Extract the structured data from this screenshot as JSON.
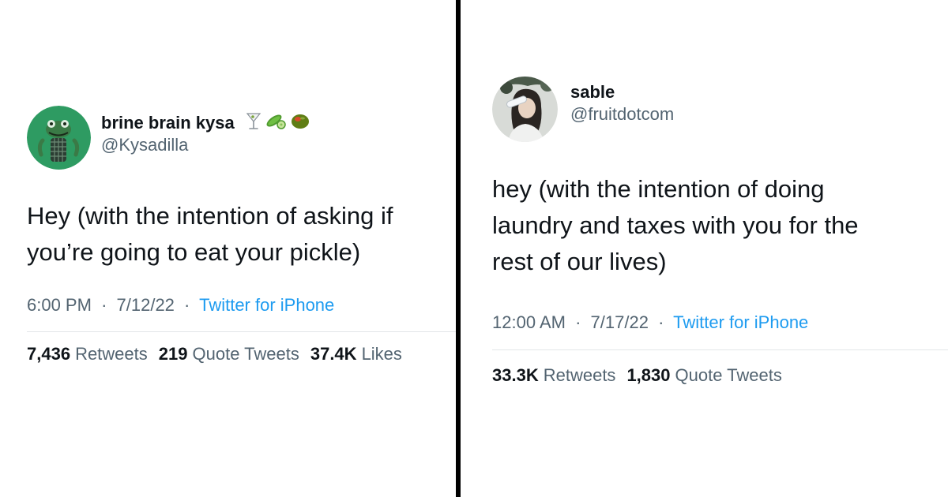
{
  "tweets": [
    {
      "display_name": "brine brain kysa",
      "emoji": [
        "martini-glass",
        "cucumber",
        "olive"
      ],
      "handle": "@Kysadilla",
      "text": "Hey (with the intention of asking if\nyou’re going to eat your pickle)",
      "time": "6:00 PM",
      "date": "7/12/22",
      "source": "Twitter for iPhone",
      "stats": [
        {
          "num": "7,436",
          "label": "Retweets"
        },
        {
          "num": "219",
          "label": "Quote Tweets"
        },
        {
          "num": "37.4K",
          "label": "Likes"
        }
      ]
    },
    {
      "display_name": "sable",
      "handle": "@fruitdotcom",
      "text": "hey (with the intention of doing\nlaundry and taxes with you for the\nrest of our lives)",
      "time": "12:00 AM",
      "date": "7/17/22",
      "source": "Twitter for iPhone",
      "stats": [
        {
          "num": "33.3K",
          "label": "Retweets"
        },
        {
          "num": "1,830",
          "label": "Quote Tweets"
        }
      ]
    }
  ],
  "meta_separator": "·",
  "colors": {
    "text_primary": "#0f1419",
    "text_secondary": "#536471",
    "link": "#1d9bf0",
    "divider": "#000000"
  }
}
